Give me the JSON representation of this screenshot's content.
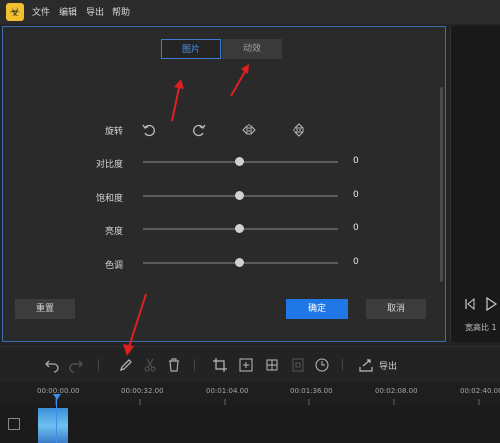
{
  "menubar": {
    "logo_glyph": "☣",
    "items": [
      "文件",
      "编辑",
      "导出",
      "帮助"
    ]
  },
  "dialog": {
    "tabs": [
      "图片",
      "动效"
    ],
    "rows": [
      {
        "label": "旋转"
      },
      {
        "label": "对比度",
        "value": "0"
      },
      {
        "label": "饱和度",
        "value": "0"
      },
      {
        "label": "亮度",
        "value": "0"
      },
      {
        "label": "色调",
        "value": "0"
      }
    ],
    "buttons": {
      "reset": "重置",
      "confirm": "确定",
      "cancel": "取消"
    }
  },
  "preview": {
    "ratio_label": "宽高比 1"
  },
  "toolbar": {
    "export_label": "导出"
  },
  "timeline": {
    "ticks": [
      "00:00:00.00",
      "00:00:32.00",
      "00:01:04.00",
      "00:01:36.00",
      "00:02:08.00",
      "00:02:40.00"
    ]
  },
  "colors": {
    "accent": "#1f78e6",
    "annotation_arrow": "#e02020"
  }
}
